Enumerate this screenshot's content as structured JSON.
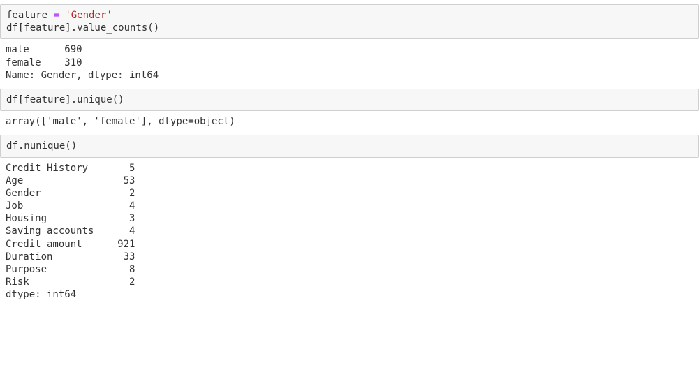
{
  "cell1": {
    "line1_var": "feature",
    "line1_eq": " = ",
    "line1_str": "'Gender'",
    "line2": "df[feature].value_counts()",
    "out_line1": "male      690",
    "out_line2": "female    310",
    "out_line3": "Name: Gender, dtype: int64"
  },
  "cell2": {
    "code": "df[feature].unique()",
    "out": "array(['male', 'female'], dtype=object)"
  },
  "cell3": {
    "code": "df.nunique()",
    "out_l1": "Credit History       5",
    "out_l2": "Age                 53",
    "out_l3": "Gender               2",
    "out_l4": "Job                  4",
    "out_l5": "Housing              3",
    "out_l6": "Saving accounts      4",
    "out_l7": "Credit amount      921",
    "out_l8": "Duration            33",
    "out_l9": "Purpose              8",
    "out_l10": "Risk                 2",
    "out_l11": "dtype: int64"
  }
}
